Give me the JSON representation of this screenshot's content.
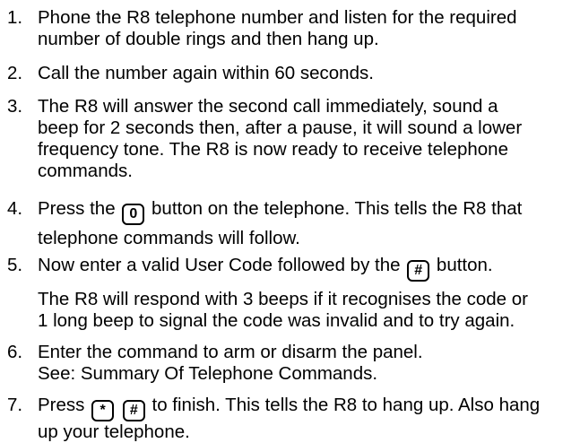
{
  "steps": [
    {
      "number": "1.",
      "lines": [
        "Phone the R8 telephone number and listen for the required",
        "number of double rings and then hang up."
      ]
    },
    {
      "number": "2.",
      "lines": [
        "Call the number again within 60 seconds."
      ]
    },
    {
      "number": "3.",
      "lines": [
        "The R8 will answer the second call immediately, sound a",
        "beep for 2 seconds then, after a pause, it will sound a lower",
        "frequency tone. The R8 is now ready to receive telephone",
        "commands."
      ]
    },
    {
      "number": "4.",
      "line1_before": "Press the",
      "key": "0",
      "line1_after": "button on the telephone. This tells the R8 that",
      "line2": "telephone commands will follow."
    },
    {
      "number": "5.",
      "line1_before": "Now enter a valid User Code followed by the",
      "key": "#",
      "line1_after": "button.",
      "note_lines": [
        "The R8 will respond with 3 beeps if it recognises the code or",
        "1 long beep to signal the code was invalid and to try again."
      ]
    },
    {
      "number": "6.",
      "lines": [
        "Enter the command to arm or disarm the panel.",
        "See: Summary Of Telephone Commands."
      ]
    },
    {
      "number": "7.",
      "line1_before": "Press",
      "key1": "*",
      "key2": "#",
      "line1_after": "to finish. This tells the R8 to hang up. Also hang",
      "line2": "up your telephone."
    }
  ]
}
